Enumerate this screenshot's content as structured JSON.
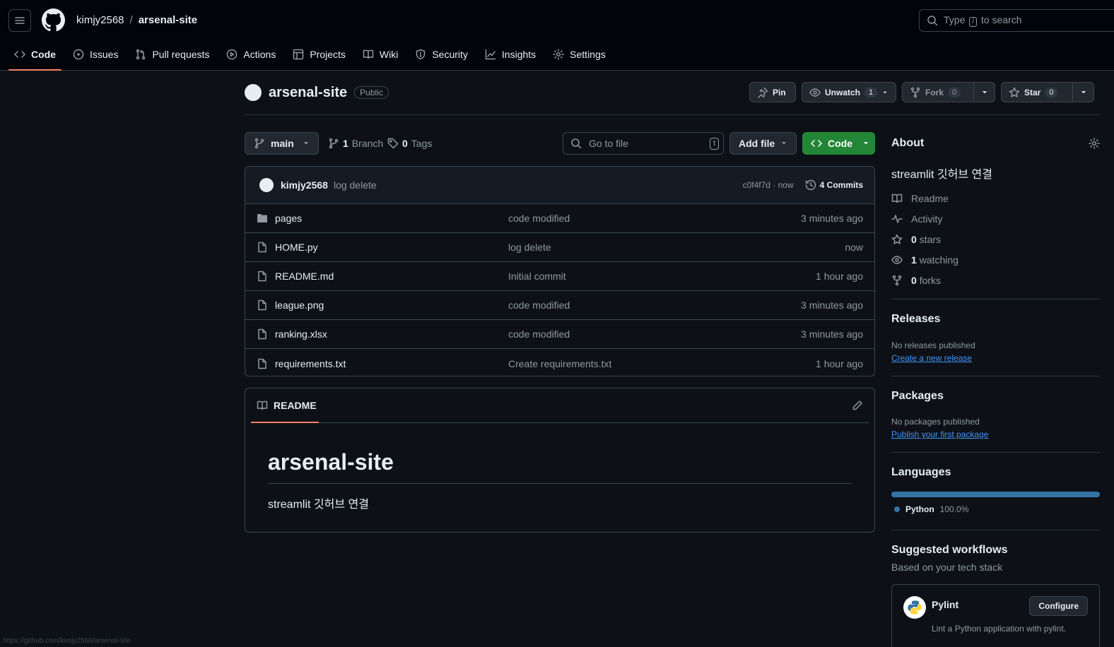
{
  "header": {
    "owner": "kimjy2568",
    "separator": "/",
    "repo": "arsenal-site",
    "search_prefix": "Type",
    "search_key": "/",
    "search_suffix": "to search"
  },
  "tabs": [
    {
      "label": "Code",
      "icon": "code-icon",
      "active": true
    },
    {
      "label": "Issues",
      "icon": "issue-icon"
    },
    {
      "label": "Pull requests",
      "icon": "pull-request-icon"
    },
    {
      "label": "Actions",
      "icon": "play-icon"
    },
    {
      "label": "Projects",
      "icon": "table-icon"
    },
    {
      "label": "Wiki",
      "icon": "book-icon"
    },
    {
      "label": "Security",
      "icon": "shield-icon"
    },
    {
      "label": "Insights",
      "icon": "graph-icon"
    },
    {
      "label": "Settings",
      "icon": "gear-icon"
    }
  ],
  "repo_header": {
    "name": "arsenal-site",
    "visibility": "Public",
    "pin_label": "Pin",
    "unwatch_label": "Unwatch",
    "watch_count": "1",
    "fork_label": "Fork",
    "fork_count": "0",
    "star_label": "Star",
    "star_count": "0"
  },
  "controls": {
    "branch": "main",
    "branch_count": "1",
    "branch_label": "Branch",
    "tag_count": "0",
    "tag_label": "Tags",
    "goto_placeholder": "Go to file",
    "goto_key": "t",
    "add_file_label": "Add file",
    "code_label": "Code"
  },
  "latest_commit": {
    "author": "kimjy2568",
    "message": "log delete",
    "hash_time": "c0f4f7d · now",
    "commits_label": "4 Commits"
  },
  "files": [
    {
      "name": "pages",
      "type": "folder",
      "message": "code modified",
      "time": "3 minutes ago"
    },
    {
      "name": "HOME.py",
      "type": "file",
      "message": "log delete",
      "time": "now"
    },
    {
      "name": "README.md",
      "type": "file",
      "message": "Initial commit",
      "time": "1 hour ago"
    },
    {
      "name": "league.png",
      "type": "file",
      "message": "code modified",
      "time": "3 minutes ago"
    },
    {
      "name": "ranking.xlsx",
      "type": "file",
      "message": "code modified",
      "time": "3 minutes ago"
    },
    {
      "name": "requirements.txt",
      "type": "file",
      "message": "Create requirements.txt",
      "time": "1 hour ago"
    }
  ],
  "readme": {
    "tab_label": "README",
    "heading": "arsenal-site",
    "body": "streamlit 깃허브 연결"
  },
  "about": {
    "title": "About",
    "description": "streamlit 깃허브 연결",
    "readme_label": "Readme",
    "activity_label": "Activity",
    "stars_count": "0",
    "stars_label": "stars",
    "watching_count": "1",
    "watching_label": "watching",
    "forks_count": "0",
    "forks_label": "forks"
  },
  "releases": {
    "title": "Releases",
    "empty": "No releases published",
    "link": "Create a new release"
  },
  "packages": {
    "title": "Packages",
    "empty": "No packages published",
    "link": "Publish your first package"
  },
  "languages": {
    "title": "Languages",
    "items": [
      {
        "name": "Python",
        "percent": "100.0%",
        "color": "#3572a5",
        "fraction": 1.0
      }
    ]
  },
  "workflows": {
    "title": "Suggested workflows",
    "subtitle": "Based on your tech stack",
    "card_name": "Pylint",
    "card_button": "Configure",
    "card_desc": "Lint a Python application with pylint."
  },
  "status_url": "https://github.com/kimjy2568/arsenal-site",
  "colors": {
    "accent_underline": "#f78166",
    "code_button": "#238636",
    "link": "#4493f8",
    "python": "#3572a5"
  }
}
